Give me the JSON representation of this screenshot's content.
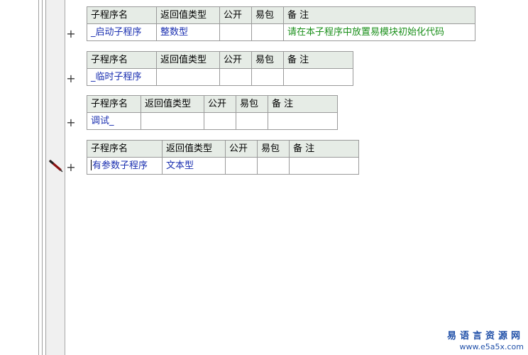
{
  "headers": {
    "name": "子程序名",
    "return_type": "返回值类型",
    "public": "公开",
    "easy_package": "易包",
    "remark": "备 注"
  },
  "subroutines": [
    {
      "expand_symbol": "+",
      "name": "_启动子程序",
      "return_type": "整数型",
      "public": "",
      "easy_package": "",
      "remark": "请在本子程序中放置易模块初始化代码"
    },
    {
      "expand_symbol": "+",
      "name": "_临时子程序",
      "return_type": "",
      "public": "",
      "easy_package": "",
      "remark": ""
    },
    {
      "expand_symbol": "+",
      "name": "调试_",
      "return_type": "",
      "public": "",
      "easy_package": "",
      "remark": ""
    },
    {
      "expand_symbol": "+",
      "name": "有参数子程序",
      "return_type": "文本型",
      "public": "",
      "easy_package": "",
      "remark": ""
    }
  ],
  "watermark": {
    "title": "易语言资源网",
    "url": "www.e5a5x.com"
  },
  "icons": {
    "edit_marker": "pencil-icon"
  },
  "colors": {
    "header_bg": "#e6ece6",
    "name_text": "#1a2fb0",
    "remark_text": "#1a8f1a",
    "watermark": "#1f4fa8"
  }
}
